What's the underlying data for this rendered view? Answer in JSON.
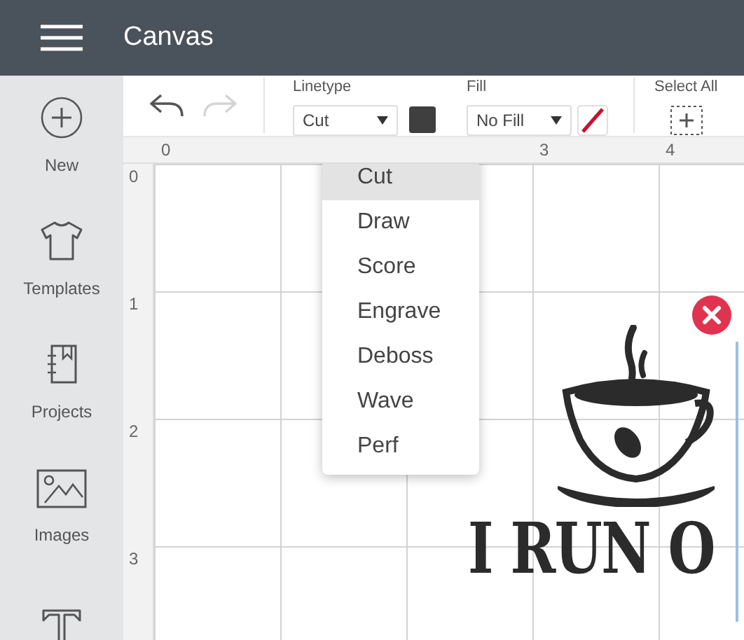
{
  "header": {
    "title": "Canvas"
  },
  "sidebar": {
    "items": [
      {
        "kind": "new",
        "label": "New"
      },
      {
        "kind": "templates",
        "label": "Templates"
      },
      {
        "kind": "projects",
        "label": "Projects"
      },
      {
        "kind": "images",
        "label": "Images"
      },
      {
        "kind": "text"
      }
    ]
  },
  "toolbar": {
    "undo": {
      "disabled": false
    },
    "redo": {
      "disabled": true
    },
    "linetype": {
      "label": "Linetype",
      "value": "Cut",
      "color": "#3f3f3f"
    },
    "fill": {
      "label": "Fill",
      "value": "No Fill"
    },
    "select_all": {
      "label": "Select All"
    }
  },
  "ruler": {
    "top": [
      {
        "kind": "number",
        "label": "0"
      },
      {
        "kind": "covered"
      },
      {
        "kind": "covered"
      },
      {
        "kind": "number",
        "label": "3"
      },
      {
        "kind": "number",
        "label": "4"
      }
    ],
    "left": [
      {
        "label": "0"
      },
      {
        "label": "1"
      },
      {
        "label": "2"
      },
      {
        "label": "3"
      }
    ]
  },
  "linetype_menu": {
    "items": [
      {
        "label": "Cut",
        "selected": true
      },
      {
        "label": "Draw",
        "selected": false
      },
      {
        "label": "Score",
        "selected": false
      },
      {
        "label": "Engrave",
        "selected": false
      },
      {
        "label": "Deboss",
        "selected": false
      },
      {
        "label": "Wave",
        "selected": false
      },
      {
        "label": "Perf",
        "selected": false
      }
    ]
  },
  "canvas": {
    "design_text": "I RUN O",
    "selected": true
  }
}
